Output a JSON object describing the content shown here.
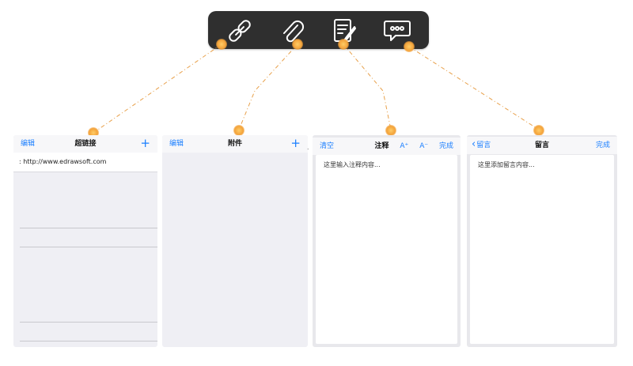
{
  "toolbar": {
    "icons": [
      "hyperlink-icon",
      "attachment-icon",
      "annotation-icon",
      "message-icon"
    ]
  },
  "colors": {
    "toolbar_bg": "#2f2f2f",
    "accent": "#1b7fff",
    "dot": "#f3a23a",
    "connector": "#e8a04a"
  },
  "hyperlink_panel": {
    "edit_label": "编辑",
    "title": "超链接",
    "add_icon": "+",
    "link_value": ": http://www.edrawsoft.com"
  },
  "attachment_panel": {
    "edit_label": "编辑",
    "title": "附件",
    "add_icon": "+"
  },
  "annotation_panel": {
    "clear_label": "清空",
    "title": "注释",
    "font_increase": "A⁺",
    "font_decrease": "A⁻",
    "done_label": "完成",
    "placeholder": "这里输入注释内容..."
  },
  "message_panel": {
    "back_label": "留言",
    "title": "留言",
    "done_label": "完成",
    "placeholder": "这里添加留言内容..."
  }
}
